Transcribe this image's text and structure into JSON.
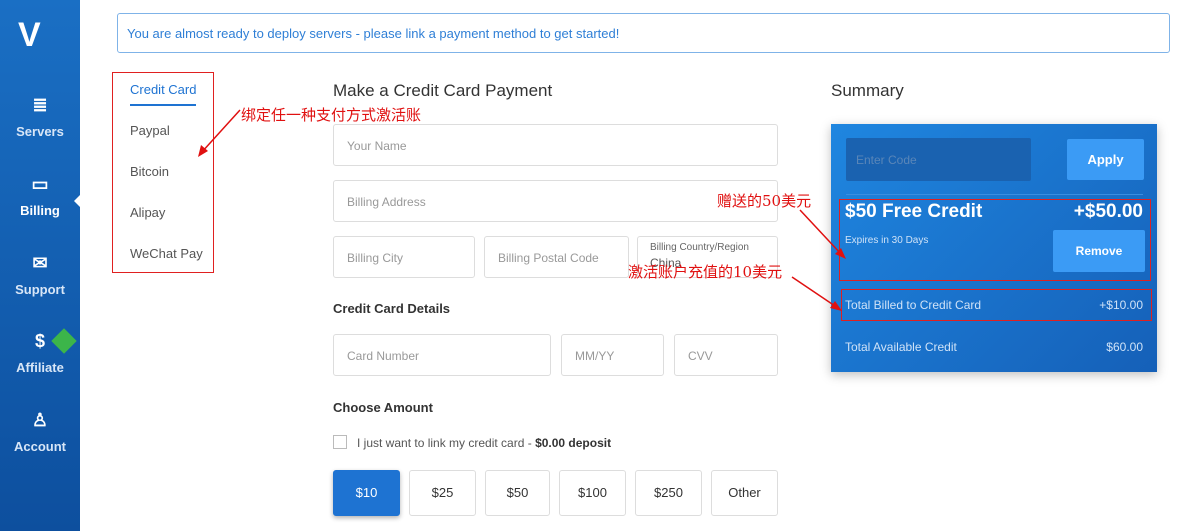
{
  "sidebar": {
    "logo": "V",
    "items": [
      {
        "label": "Servers",
        "icon": "≣"
      },
      {
        "label": "Billing",
        "icon": "▭"
      },
      {
        "label": "Support",
        "icon": "✉"
      },
      {
        "label": "Affiliate",
        "icon": "$"
      },
      {
        "label": "Account",
        "icon": "♙"
      }
    ]
  },
  "banner": "You are almost ready to deploy servers - please link a payment method to get started!",
  "methods": [
    "Credit Card",
    "Paypal",
    "Bitcoin",
    "Alipay",
    "WeChat Pay"
  ],
  "annotations": {
    "bind_any": "绑定任一种支付方式激活账",
    "free50": "赠送的50美元",
    "recharge10": "激活账户充值的10美元"
  },
  "form": {
    "title": "Make a Credit Card Payment",
    "name": "Your Name",
    "address": "Billing Address",
    "city": "Billing City",
    "postal": "Billing Postal Code",
    "country_label": "Billing Country/Region",
    "country": "China",
    "card_title": "Credit Card Details",
    "card": "Card Number",
    "exp": "MM/YY",
    "cvv": "CVV",
    "amount_title": "Choose Amount",
    "link_only": "I just want to link my credit card - ",
    "deposit": "$0.00 deposit",
    "amounts": [
      "$10",
      "$25",
      "$50",
      "$100",
      "$250",
      "Other"
    ]
  },
  "summary": {
    "title": "Summary",
    "code_placeholder": "Enter Code",
    "apply": "Apply",
    "credit_title": "$50 Free Credit",
    "credit_value": "+$50.00",
    "expires": "Expires in 30 Days",
    "remove": "Remove",
    "billed_label": "Total Billed to Credit Card",
    "billed_value": "+$10.00",
    "available_label": "Total Available Credit",
    "available_value": "$60.00"
  }
}
